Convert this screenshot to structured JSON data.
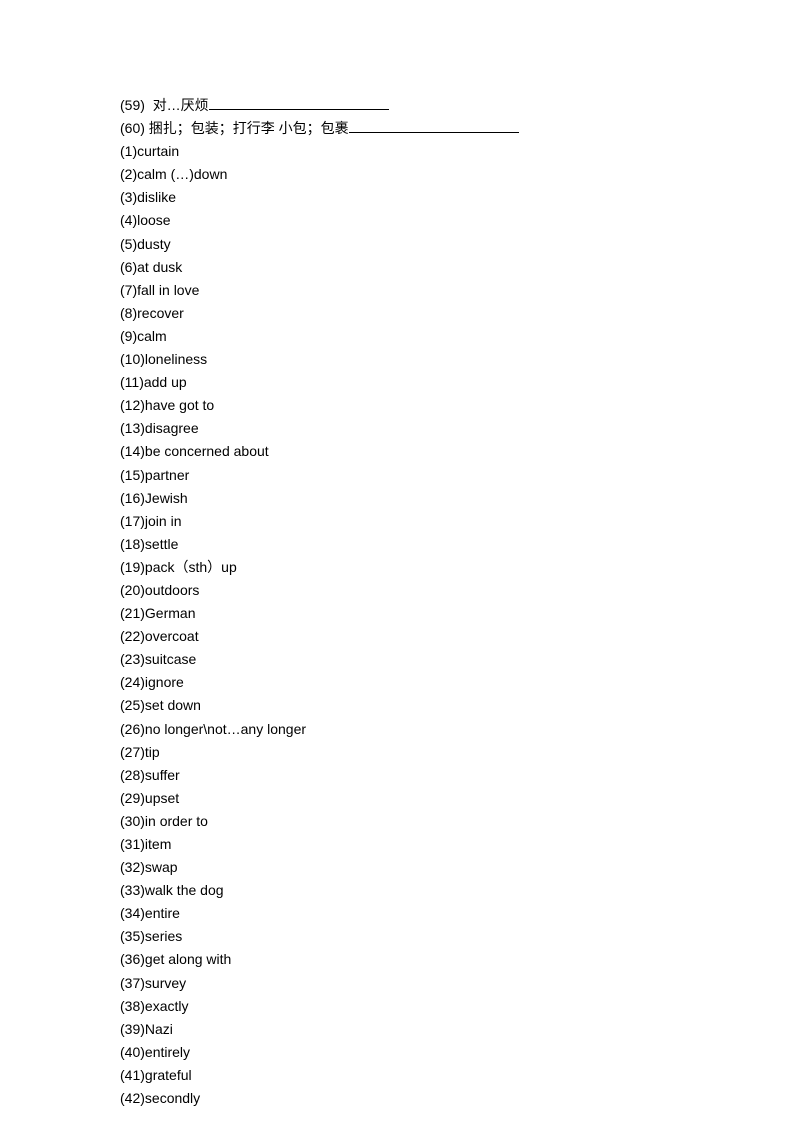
{
  "prompts": [
    {
      "num": "(59)",
      "text": "对…厌烦",
      "gap_before": "  ",
      "underline": "long"
    },
    {
      "num": "(60)",
      "text": "捆扎；包装；打行李   小包；包裹",
      "gap_before": " ",
      "underline": "xlong"
    }
  ],
  "answers": [
    {
      "num": "(1)",
      "text": "curtain"
    },
    {
      "num": "(2)",
      "text": "calm (…)down"
    },
    {
      "num": "(3)",
      "text": "dislike"
    },
    {
      "num": "(4)",
      "text": "loose"
    },
    {
      "num": "(5)",
      "text": "dusty"
    },
    {
      "num": "(6)",
      "text": "at dusk"
    },
    {
      "num": "(7)",
      "text": "fall in love"
    },
    {
      "num": "(8)",
      "text": "recover"
    },
    {
      "num": "(9)",
      "text": "calm"
    },
    {
      "num": "(10)",
      "text": "loneliness"
    },
    {
      "num": "(11)",
      "text": "add up"
    },
    {
      "num": "(12)",
      "text": "have got to"
    },
    {
      "num": "(13)",
      "text": "disagree"
    },
    {
      "num": "(14)",
      "text": "be concerned about"
    },
    {
      "num": "(15)",
      "text": "partner"
    },
    {
      "num": "(16)",
      "text": "Jewish"
    },
    {
      "num": "(17)",
      "text": "join in"
    },
    {
      "num": "(18)",
      "text": "settle"
    },
    {
      "num": "(19)",
      "text": "pack（sth）up"
    },
    {
      "num": "(20)",
      "text": "outdoors"
    },
    {
      "num": "(21)",
      "text": "German"
    },
    {
      "num": "(22)",
      "text": "overcoat"
    },
    {
      "num": "(23)",
      "text": "suitcase"
    },
    {
      "num": "(24)",
      "text": "ignore"
    },
    {
      "num": "(25)",
      "text": "set down"
    },
    {
      "num": "(26)",
      "text": "no longer\\not…any longer"
    },
    {
      "num": "(27)",
      "text": "tip"
    },
    {
      "num": "(28)",
      "text": "suffer"
    },
    {
      "num": "(29)",
      "text": "upset"
    },
    {
      "num": "(30)",
      "text": "in order to"
    },
    {
      "num": "(31)",
      "text": "item"
    },
    {
      "num": "(32)",
      "text": "swap"
    },
    {
      "num": "(33)",
      "text": "walk the dog"
    },
    {
      "num": "(34)",
      "text": "entire"
    },
    {
      "num": "(35)",
      "text": "series"
    },
    {
      "num": "(36)",
      "text": "get along with"
    },
    {
      "num": "(37)",
      "text": "survey"
    },
    {
      "num": "(38)",
      "text": "exactly"
    },
    {
      "num": "(39)",
      "text": "Nazi"
    },
    {
      "num": "(40)",
      "text": "entirely"
    },
    {
      "num": "(41)",
      "text": "grateful"
    },
    {
      "num": "(42)",
      "text": "secondly"
    }
  ]
}
